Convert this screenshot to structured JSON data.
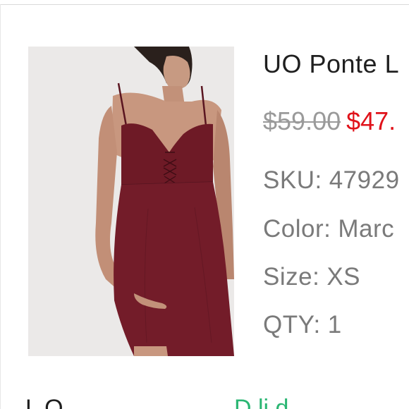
{
  "listing": {
    "title": "UO Ponte L",
    "price_original": "$59.00",
    "price_sale": "$47.",
    "sku_label": "SKU:",
    "sku_value": "47929",
    "color_label": "Color:",
    "color_value": "Marc",
    "size_label": "Size:",
    "size_value": "XS",
    "qty_label": "QTY:",
    "qty_value": "1"
  },
  "colors": {
    "sale_price": "#e0121a",
    "status": "#2bb673",
    "dress": "#6e1a26"
  },
  "bottom": {
    "left_text": "L    O",
    "right_text": "D  li    d"
  }
}
